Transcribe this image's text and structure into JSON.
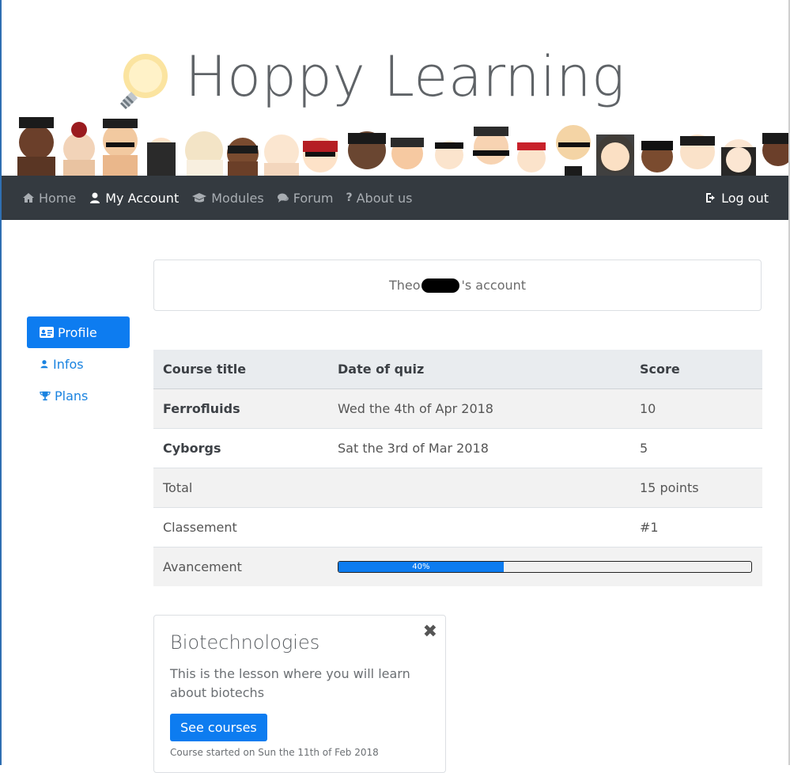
{
  "brand": {
    "name": "Hoppy Learning",
    "logo_icon": "lightbulb-icon",
    "accent": "#0d7cf0",
    "navbar_bg": "#343a40"
  },
  "navbar": {
    "items": [
      {
        "label": "Home",
        "icon": "home-icon"
      },
      {
        "label": "My Account",
        "icon": "user-icon"
      },
      {
        "label": "Modules",
        "icon": "graduation-cap-icon"
      },
      {
        "label": "Forum",
        "icon": "comments-icon"
      },
      {
        "label": "About us",
        "icon": "question-icon"
      }
    ],
    "logout": {
      "label": "Log out",
      "icon": "sign-out-icon"
    }
  },
  "sidebar": {
    "items": [
      {
        "label": "Profile",
        "icon": "id-card-icon"
      },
      {
        "label": "Infos",
        "icon": "user-icon"
      },
      {
        "label": "Plans",
        "icon": "trophy-icon"
      }
    ]
  },
  "account": {
    "name_prefix": "Theo",
    "suffix": "'s account"
  },
  "table": {
    "headers": [
      "Course title",
      "Date of quiz",
      "Score"
    ],
    "rows": [
      [
        "Ferrofluids",
        "Wed the 4th of Apr 2018",
        "10"
      ],
      [
        "Cyborgs",
        "Sat the 3rd of Mar 2018",
        "5"
      ]
    ],
    "total": {
      "label": "Total",
      "value": "15 points"
    },
    "classement": {
      "label": "Classement",
      "value": "#1"
    },
    "avancement": {
      "label": "Avancement",
      "value": "40%",
      "percent": 40
    }
  },
  "course": {
    "title": "Biotechnologies",
    "text": "This is the lesson where you will learn about biotechs",
    "button": "See courses",
    "meta": "Course started on Sun the 11th of Feb 2018"
  }
}
